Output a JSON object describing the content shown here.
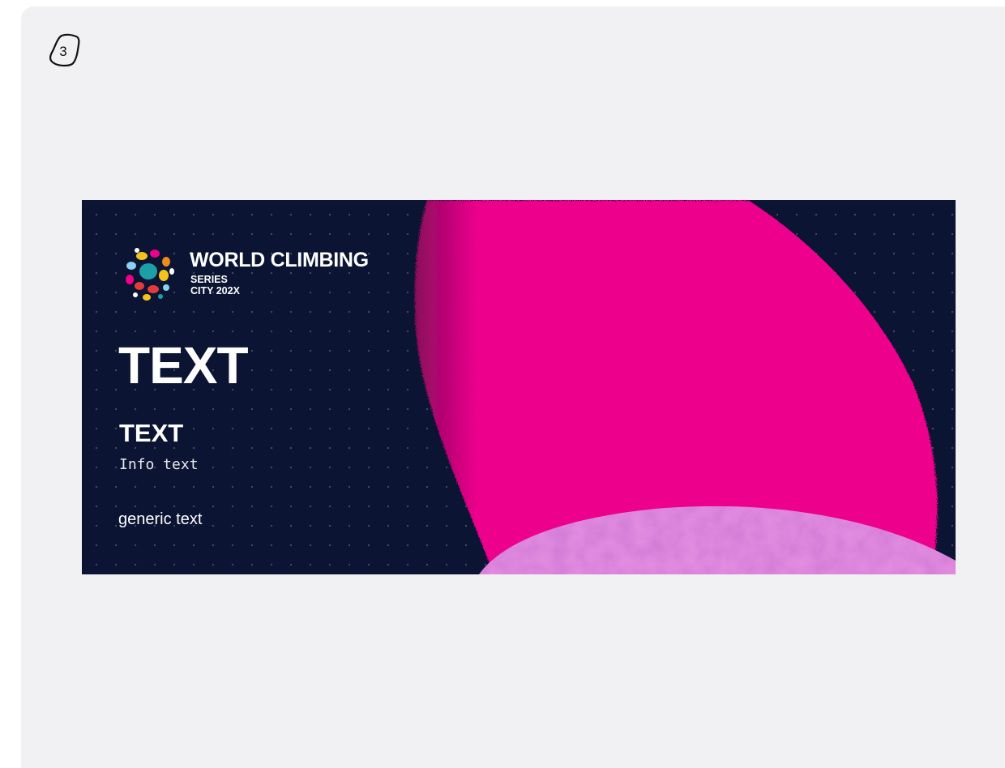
{
  "step": {
    "number": "3"
  },
  "banner": {
    "background_color": "#0b1432",
    "accent_color": "#ec008c",
    "secondary_color": "#d07ad6",
    "logo": {
      "title": "WORLD CLIMBING",
      "subtitle_line1": "SERIES",
      "subtitle_line2": "CITY 202X",
      "icon": "climbing-holds-logo"
    },
    "headline": "TEXT",
    "subheadline": "TEXT",
    "info_text": "Info text",
    "generic_text": "generic text"
  }
}
